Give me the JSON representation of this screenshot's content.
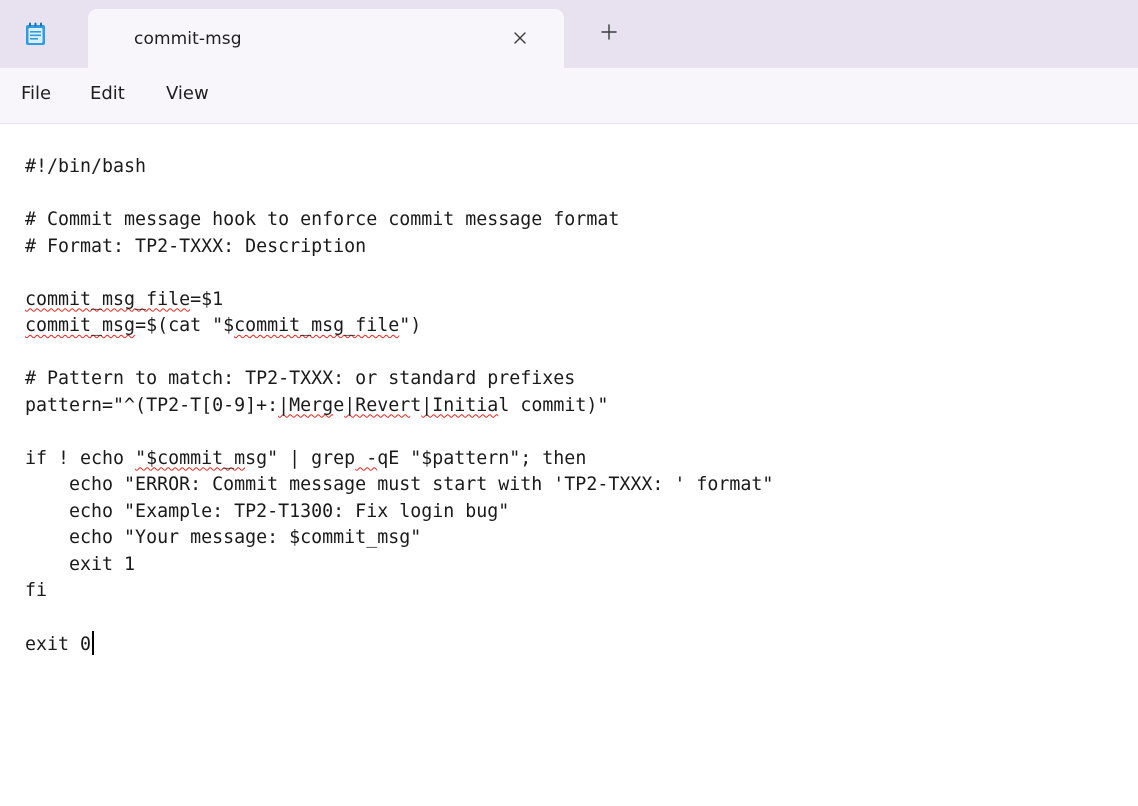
{
  "window": {
    "app_icon": "notepad-icon",
    "tab_title": "commit-msg",
    "close_tab_icon": "close-icon",
    "new_tab_icon": "plus-icon"
  },
  "menu": {
    "file": "File",
    "edit": "Edit",
    "view": "View"
  },
  "editor": {
    "lines": [
      "#!/bin/bash",
      "",
      "# Commit message hook to enforce commit message format",
      "# Format: TP2-TXXX: Description",
      "",
      "commit_msg_file=$1",
      "commit_msg=$(cat \"$commit_msg_file\")",
      "",
      "# Pattern to match: TP2-TXXX: or standard prefixes",
      "pattern=\"^(TP2-T[0-9]+:|Merge|Revert|Initial commit)\"",
      "",
      "if ! echo \"$commit_msg\" | grep -qE \"$pattern\"; then",
      "    echo \"ERROR: Commit message must start with 'TP2-TXXX: ' format\"",
      "    echo \"Example: TP2-T1300: Fix login bug\"",
      "    echo \"Your message: $commit_msg\"",
      "    exit 1",
      "fi",
      "",
      "exit 0"
    ],
    "spellcheck_words": [
      "commit_msg_file",
      "commit_msg",
      "Merge",
      "Revert",
      "Initial",
      "qE"
    ],
    "spellcheck_color": "#e0281e"
  },
  "colors": {
    "titlebar": "#e7e1f0",
    "tab": "#f8f6fb",
    "menubar": "#f8f6fb",
    "editor_bg": "#ffffff",
    "text": "#1a1a1a"
  }
}
